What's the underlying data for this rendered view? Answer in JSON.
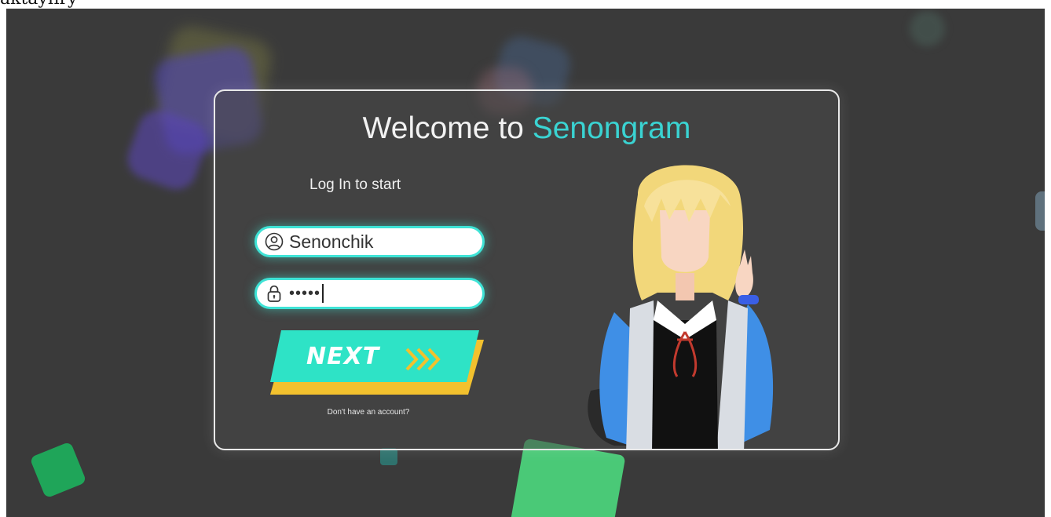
{
  "page": {
    "top_text": "aktayfiry"
  },
  "login": {
    "title_prefix": "Welcome to ",
    "title_brand": "Senongram",
    "subtitle": "Log In to start",
    "username_value": "Senonchik",
    "password_mask": "•••••",
    "next_label": "NEXT",
    "signup_link": "Don't have an account?"
  },
  "icons": {
    "username": "user-circle-icon",
    "password": "lock-icon",
    "next": "chevrons-right-icon"
  },
  "colors": {
    "background": "#3a3a3a",
    "brand": "#3ad3d2",
    "button": "#2ee3c6",
    "button_shadow": "#f2c12e",
    "field_glow": "#3ee3d6"
  }
}
